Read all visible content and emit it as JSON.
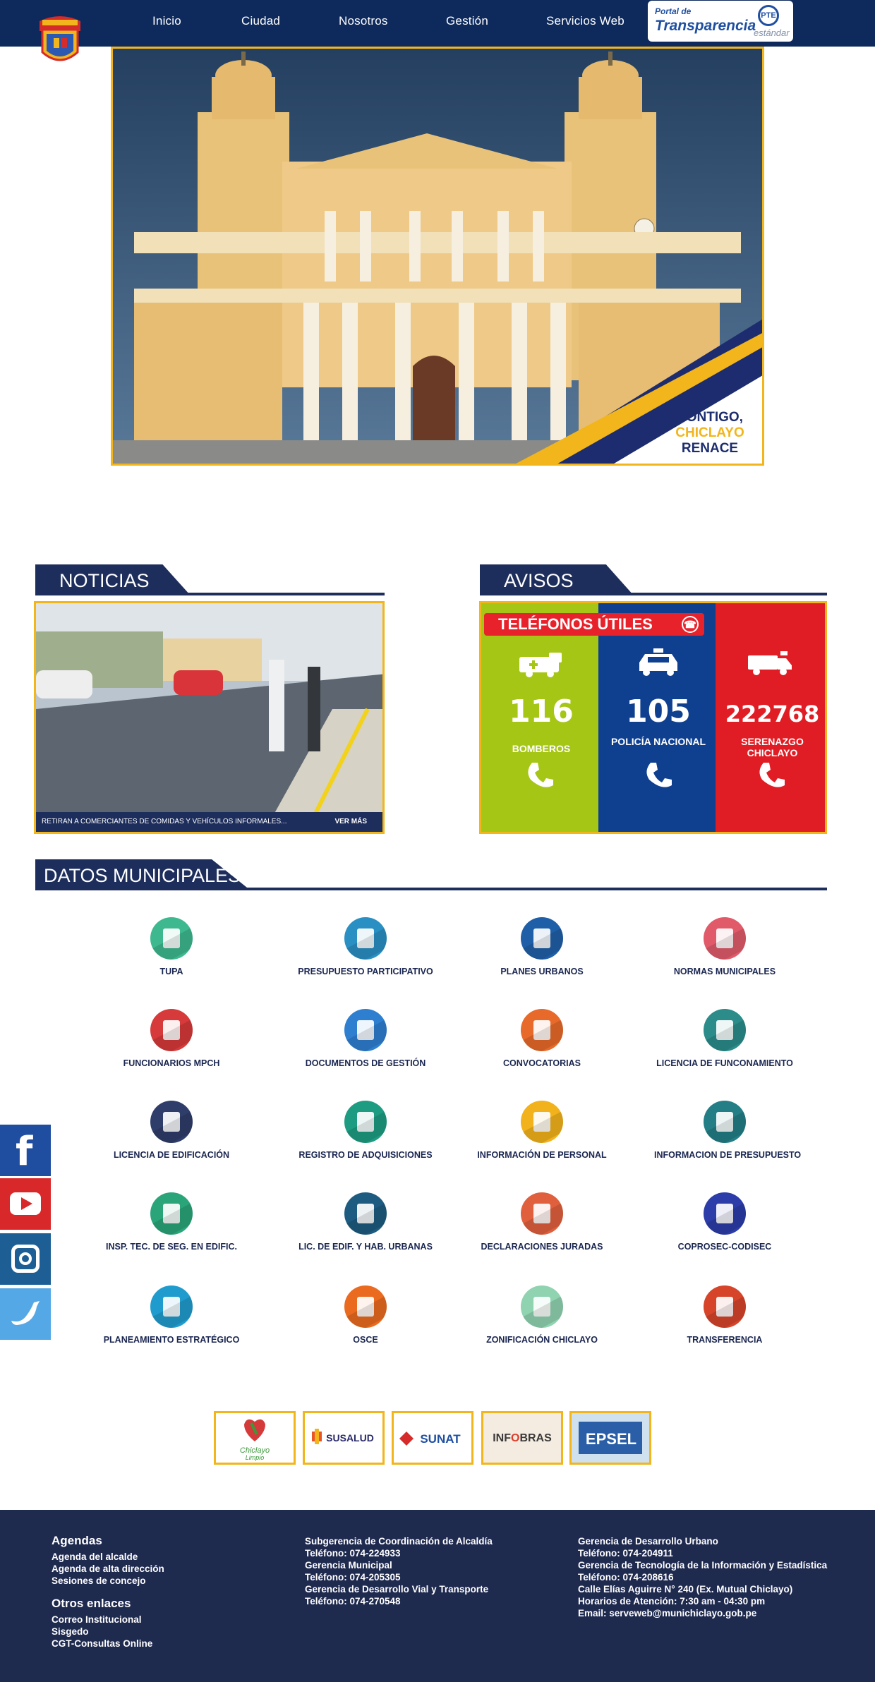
{
  "nav": {
    "items": [
      "Inicio",
      "Ciudad",
      "Nosotros",
      "Gestión",
      "Servicios Web"
    ],
    "pte_line1": "Portal de",
    "pte_line2": "Transparencia",
    "pte_badge": "PTE",
    "pte_line3": "estándar"
  },
  "hero": {
    "badge_line1": "CONTIGO,",
    "badge_line2": "CHICLAYO",
    "badge_line3": "RENACE"
  },
  "noticias": {
    "title": "NOTICIAS",
    "caption": "RETIRAN A COMERCIANTES DE COMIDAS Y VEHÍCULOS INFORMALES...",
    "more": "VER MÁS"
  },
  "avisos": {
    "title": "AVISOS",
    "banner": "TELÉFONOS ÚTILES",
    "phones": [
      {
        "number": "116",
        "label": "BOMBEROS",
        "color": "#a6c616"
      },
      {
        "number": "105",
        "label": "POLICÍA NACIONAL",
        "color": "#0f3f8f"
      },
      {
        "number": "222768",
        "label": "SERENAZGO CHICLAYO",
        "color": "#e01d24"
      }
    ]
  },
  "datos": {
    "title": "DATOS MUNICIPALES",
    "items": [
      {
        "label": "TUPA",
        "color": "#3db88f",
        "icon": "book-icon"
      },
      {
        "label": "PRESUPUESTO PARTICIPATIVO",
        "color": "#2a8fc2",
        "icon": "gear-people-icon"
      },
      {
        "label": "PLANES URBANOS",
        "color": "#1f5fa8",
        "icon": "bookmark-icon"
      },
      {
        "label": "NORMAS MUNICIPALES",
        "color": "#e05a6a",
        "icon": "wallet-icon"
      },
      {
        "label": "FUNCIONARIOS MPCH",
        "color": "#d63a3a",
        "icon": "user-icon"
      },
      {
        "label": "DOCUMENTOS DE GESTIÓN",
        "color": "#2f7fd1",
        "icon": "documents-icon"
      },
      {
        "label": "CONVOCATORIAS",
        "color": "#e86a2a",
        "icon": "group-icon"
      },
      {
        "label": "LICENCIA DE FUNCONAMIENTO",
        "color": "#2b8c8a",
        "icon": "document-icon"
      },
      {
        "label": "LICENCIA DE EDIFICACIÓN",
        "color": "#2f3d6a",
        "icon": "file-icon"
      },
      {
        "label": "REGISTRO DE ADQUISICIONES",
        "color": "#1d9c82",
        "icon": "checklist-icon"
      },
      {
        "label": "INFORMACIÓN DE PERSONAL",
        "color": "#f2b21b",
        "icon": "people-icon"
      },
      {
        "label": "INFORMACION DE PRESUPUESTO",
        "color": "#237e86",
        "icon": "chart-down-icon"
      },
      {
        "label": "INSP. TEC. DE SEG. EN EDIFIC.",
        "color": "#2aa57a",
        "icon": "network-icon"
      },
      {
        "label": "LIC. DE EDIF. Y HAB. URBANAS",
        "color": "#1d5c80",
        "icon": "image-icon"
      },
      {
        "label": "DECLARACIONES JURADAS",
        "color": "#e0603d",
        "icon": "bars-icon"
      },
      {
        "label": "COPROSEC-CODISEC",
        "color": "#2c3ca8",
        "icon": "warning-icon"
      },
      {
        "label": "PLANEAMIENTO ESTRATÉGICO",
        "color": "#1f9ccd",
        "icon": "page-icon"
      },
      {
        "label": "OSCE",
        "color": "#ea6a1f",
        "icon": "search-icon"
      },
      {
        "label": "ZONIFICACIÓN CHICLAYO",
        "color": "#8fd3b0",
        "icon": "map-pin-icon"
      },
      {
        "label": "TRANSFERENCIA",
        "color": "#d6442a",
        "icon": "share-icon"
      }
    ]
  },
  "partners": [
    {
      "name": "Chiclayo Limpio",
      "icon": "chiclayo-limpio-logo"
    },
    {
      "name": "SUSALUD",
      "icon": "susalud-logo"
    },
    {
      "name": "SUNAT",
      "icon": "sunat-logo"
    },
    {
      "name": "INFOBRAS",
      "icon": "infobras-logo"
    },
    {
      "name": "EPSEL",
      "icon": "epsel-logo"
    }
  ],
  "social": [
    "facebook-icon",
    "youtube-icon",
    "instagram-icon",
    "twitter-icon"
  ],
  "footer": {
    "col1": {
      "heading1": "Agendas",
      "links1": [
        "Agenda del alcalde",
        "Agenda de alta dirección",
        "Sesiones de concejo"
      ],
      "heading2": "Otros enlaces",
      "links2": [
        "Correo Institucional",
        "Sisgedo",
        "CGT-Consultas Online"
      ]
    },
    "col2": [
      "Subgerencia de Coordinación de Alcaldía",
      "Teléfono: 074-224933",
      "Gerencia Municipal",
      "Teléfono: 074-205305",
      "Gerencia de Desarrollo Vial y Transporte",
      "Teléfono: 074-270548"
    ],
    "col3": [
      "Gerencia de Desarrollo Urbano",
      "Teléfono: 074-204911",
      "Gerencia de Tecnología de la Información y Estadística",
      "Teléfono: 074-208616",
      "Calle Elías Aguirre N° 240 (Ex. Mutual Chiclayo)",
      "Horarios de Atención: 7:30 am - 04:30 pm",
      "Email: serveweb@munichiclayo.gob.pe"
    ]
  }
}
